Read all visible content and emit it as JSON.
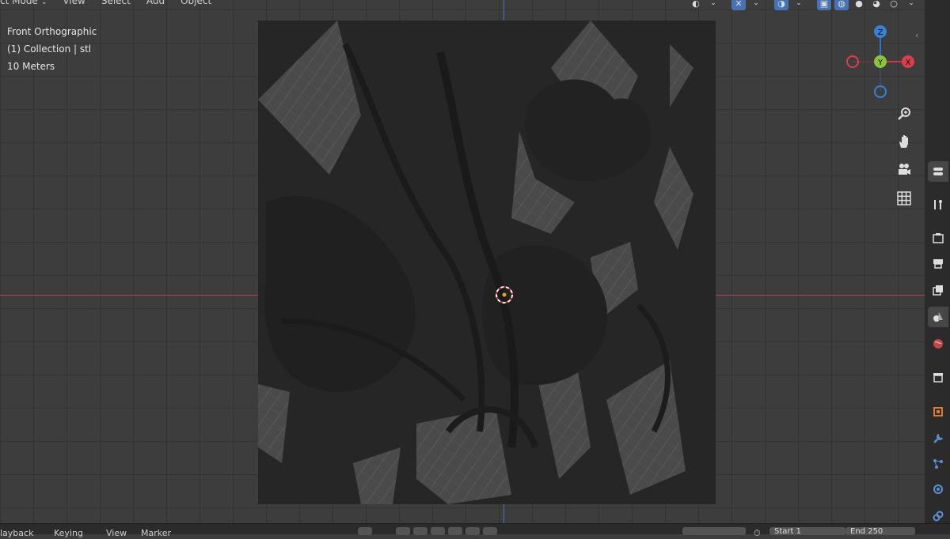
{
  "header": {
    "mode_label": "ct Mode",
    "menu": [
      "View",
      "Select",
      "Add",
      "Object"
    ]
  },
  "overlay": {
    "view_name": "Front Orthographic",
    "collection": "(1) Collection | stl",
    "scale": "10 Meters"
  },
  "gizmo": {
    "z_label": "Z",
    "y_label": "Y",
    "x_label": "X"
  },
  "nav_buttons": [
    "zoom-icon",
    "hand-pan-icon",
    "camera-icon",
    "grid-icon"
  ],
  "property_tabs": [
    "tool-icon",
    "scene-tool-icon",
    "render-icon",
    "output-icon",
    "view-layer-icon",
    "scene-icon",
    "world-icon",
    "collection-icon",
    "object-icon",
    "modifier-icon",
    "particles-icon",
    "physics-icon",
    "constraints-icon"
  ],
  "timeline": {
    "playback": "layback",
    "keying": "Keying",
    "view": "View",
    "marker": "Marker",
    "start_label": "Start",
    "start_value": "1",
    "end_label": "End",
    "end_value": "250"
  },
  "colors": {
    "x_axis": "#b5454d",
    "z_axis": "#3f77b0",
    "accent": "#4772b3"
  }
}
